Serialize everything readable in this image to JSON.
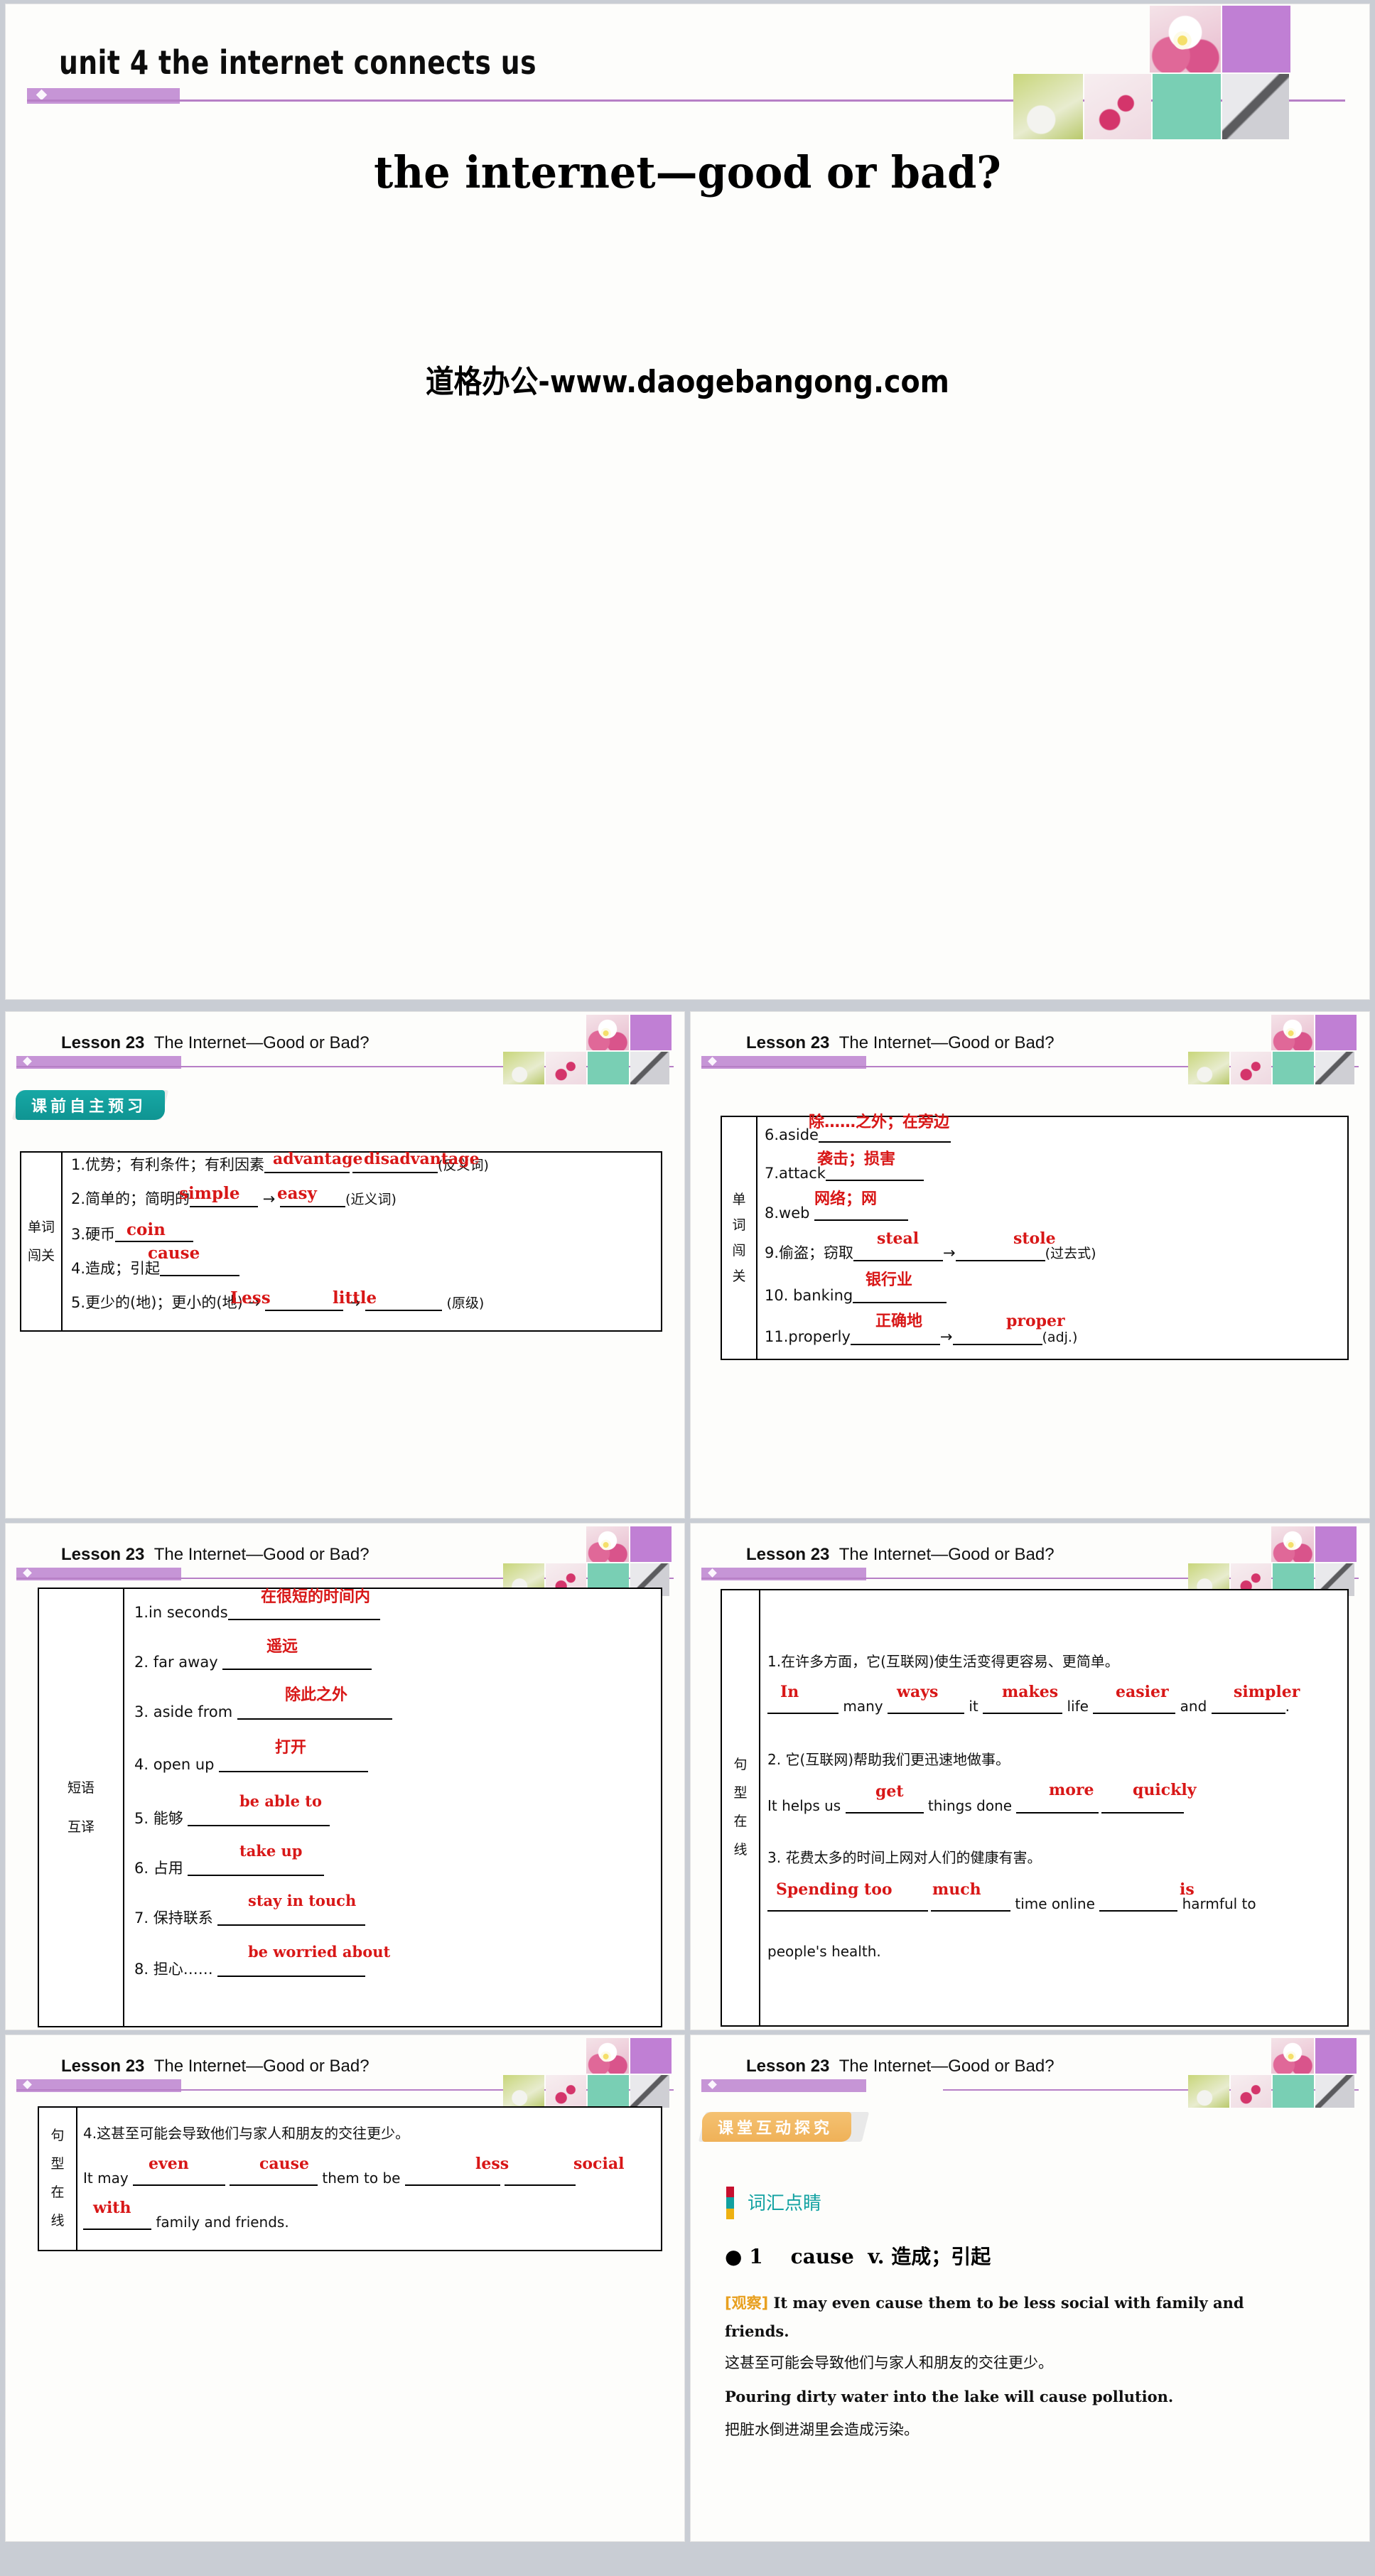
{
  "hero": {
    "unit_title": "unit 4   the internet connects us",
    "main_title": "the internet—good or bad?",
    "watermark": "道格办公-www.daogebangong.com"
  },
  "slide_header": {
    "lesson": "Lesson 23",
    "lesson_title": "The Internet—Good or Bad?"
  },
  "badges": {
    "preview": "课前自主预习",
    "explore": "课堂互动探究"
  },
  "slide2": {
    "row_label": "单词\n闯关",
    "row_label_chars": [
      "单词",
      "闯关"
    ],
    "items": [
      {
        "num": "1.",
        "cn": "优势；有利条件；有利因素",
        "answers": [
          "advantage",
          "disadvantage"
        ],
        "note": "(反义词)"
      },
      {
        "num": "2.",
        "cn": "简单的；简明的",
        "answers": [
          "simple",
          "easy"
        ],
        "arrow": "→",
        "note": "(近义词)"
      },
      {
        "num": "3.",
        "cn": "硬币",
        "answers": [
          "coin"
        ],
        "note": ""
      },
      {
        "num": "4.",
        "cn": "造成；引起",
        "answers": [
          "cause"
        ],
        "note": ""
      },
      {
        "num": "5.",
        "cn": "更少的(地)；更小的(地)",
        "answers": [
          "Less",
          "little"
        ],
        "arrow": "→",
        "note": "(原级)"
      }
    ]
  },
  "slide3": {
    "row_label_chars": [
      "单",
      "词",
      "闯",
      "关"
    ],
    "items": [
      {
        "num": "6.",
        "word": "aside",
        "answers": [
          "除……之外；在旁边"
        ],
        "note": ""
      },
      {
        "num": "7.",
        "word": "attack",
        "answers": [
          "袭击；损害"
        ],
        "note": ""
      },
      {
        "num": "8.",
        "word": "web",
        "answers": [
          "网络；网"
        ],
        "note": ""
      },
      {
        "num": "9.",
        "word": "偷盗；窃取",
        "answers": [
          "steal",
          "stole"
        ],
        "note": "(过去式)"
      },
      {
        "num": "10.",
        "word": "banking",
        "answers": [
          "银行业"
        ],
        "note": ""
      },
      {
        "num": "11.",
        "word": "properly",
        "answers": [
          "正确地",
          "proper"
        ],
        "note": "(adj.)"
      }
    ]
  },
  "slide4": {
    "row_label_chars": [
      "短语",
      "互译"
    ],
    "items": [
      {
        "num": "1.",
        "prompt": "in seconds",
        "answer": "在很短的时间内"
      },
      {
        "num": "2.",
        "prompt": "far away",
        "answer": "遥远"
      },
      {
        "num": "3.",
        "prompt": "aside from",
        "answer": "除此之外"
      },
      {
        "num": "4.",
        "prompt": "open up",
        "answer": "打开"
      },
      {
        "num": "5.",
        "prompt": "能够",
        "answer": "be able to"
      },
      {
        "num": "6.",
        "prompt": "占用",
        "answer": "take up"
      },
      {
        "num": "7.",
        "prompt": "保持联系",
        "answer": "stay in touch"
      },
      {
        "num": "8.",
        "prompt": "担心……",
        "answer": "be worried about"
      }
    ]
  },
  "slide5": {
    "row_label_chars": [
      "句",
      "型",
      "在",
      "线"
    ],
    "items": [
      {
        "num": "1.",
        "cn": "在许多方面，它(互联网)使生活变得更容易、更简单。",
        "en_parts": [
          "",
          " many ",
          " it ",
          " life ",
          " and ",
          "."
        ],
        "answers": [
          "In",
          "ways",
          "makes",
          "easier",
          "simpler"
        ]
      },
      {
        "num": "2.",
        "cn": "它(互联网)帮助我们更迅速地做事。",
        "en_parts": [
          "It helps us ",
          " things done ",
          " ",
          "."
        ],
        "answers": [
          "get",
          "more",
          "quickly"
        ]
      },
      {
        "num": "3.",
        "cn": "花费太多的时间上网对人们的健康有害。",
        "en_parts": [
          "",
          " ",
          " time online ",
          " harmful to",
          "people's health."
        ],
        "answers": [
          "Spending too",
          "much",
          "is"
        ]
      }
    ]
  },
  "slide6": {
    "row_label_chars": [
      "句",
      "型",
      "在",
      "线"
    ],
    "item": {
      "num": "4.",
      "cn": "这甚至可能会导致他们与家人和朋友的交往更少。",
      "en_prefix": "It may ",
      "answers": [
        "even",
        "cause",
        "less",
        "social",
        "with"
      ],
      "mid": " them to be ",
      "tail": " family and friends."
    }
  },
  "slide7": {
    "section_title": "词汇点睛",
    "entry_num": "1",
    "entry_word": "cause",
    "entry_pos": "v.",
    "entry_cn": "造成；引起",
    "observe_tag": "[观察]",
    "lines": [
      "It may even cause them to be less social with family and",
      "friends.",
      "这甚至可能会导致他们与家人和朋友的交往更少。",
      "Pouring dirty water into the lake will cause pollution.",
      "把脏水倒进湖里会造成污染。"
    ]
  },
  "colors": {
    "answer_red": "#d81717",
    "accent_purple": "#c695d6",
    "badge_teal": "#17a8a5",
    "badge_orange": "#f5c272",
    "section_teal": "#13a2a2"
  }
}
